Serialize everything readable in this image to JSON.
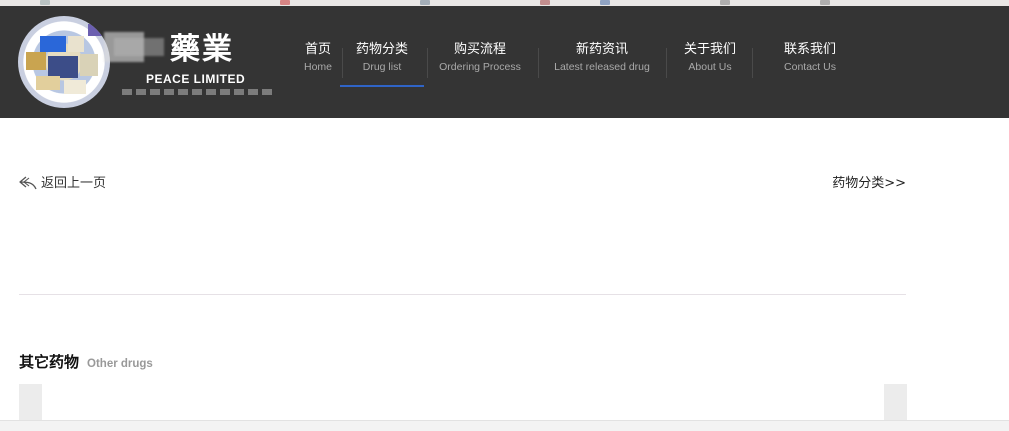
{
  "brand": {
    "name": "藥業",
    "en": "PEACE LIMITED"
  },
  "nav": [
    {
      "cn": "首页",
      "en": "Home"
    },
    {
      "cn": "药物分类",
      "en": "Drug list"
    },
    {
      "cn": "购买流程",
      "en": "Ordering Process"
    },
    {
      "cn": "新药资讯",
      "en": "Latest released drug"
    },
    {
      "cn": "关于我们",
      "en": "About Us"
    },
    {
      "cn": "联系我们",
      "en": "Contact Us"
    }
  ],
  "active_nav": "Drug list",
  "content": {
    "back_label": "返回上一页",
    "category_link": "药物分类>>",
    "other_title": "其它药物",
    "other_subtitle": "Other drugs"
  },
  "colors": {
    "header_bg": "#343434",
    "active_underline": "#2f64c7"
  },
  "icons": {
    "back": "reply-arrow-icon"
  }
}
